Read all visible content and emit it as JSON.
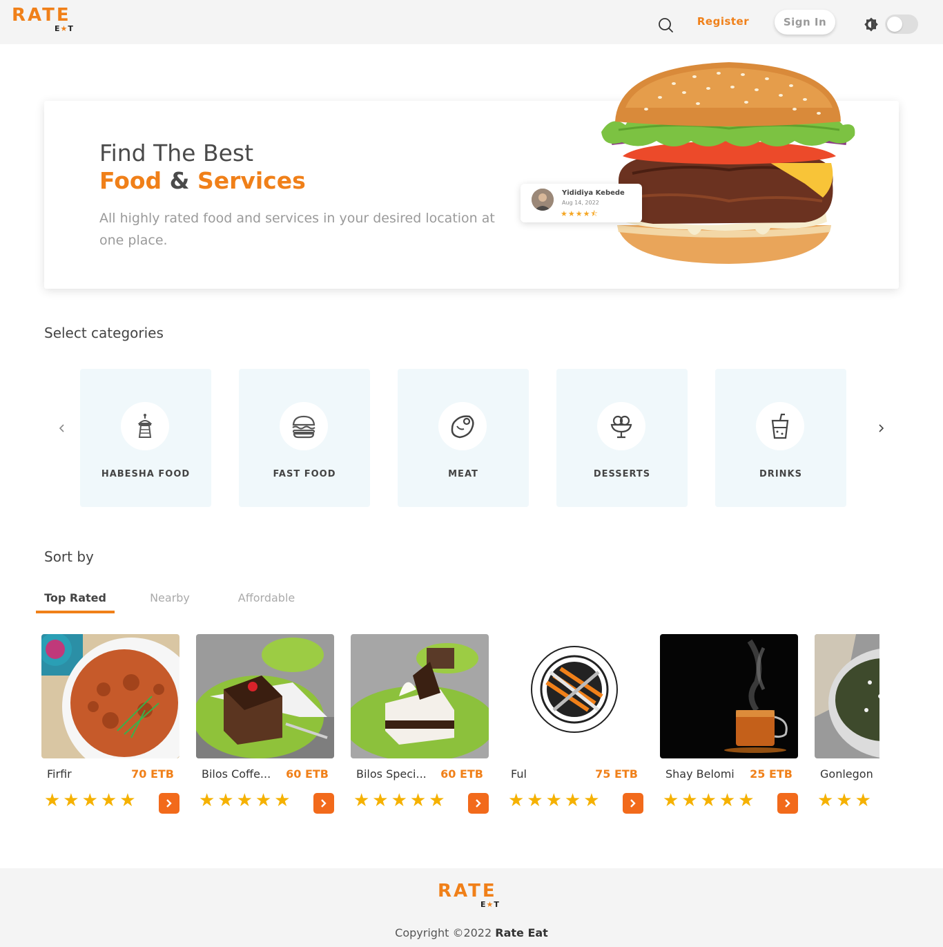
{
  "brand": {
    "logo_top": "RATE",
    "logo_bottom_left": "E",
    "logo_bottom_star": "★",
    "logo_bottom_right": "T"
  },
  "header": {
    "search_icon": "search-icon",
    "register_label": "Register",
    "signin_label": "Sign In",
    "theme_icon": "brightness-icon",
    "dark_mode_enabled": false
  },
  "hero": {
    "line1": "Find The Best",
    "line2_word1": "Food",
    "line2_amp": " & ",
    "line2_word2": "Services",
    "subtitle": "All highly rated food and services in your desired location at one place.",
    "review": {
      "name": "Yididiya Kebede",
      "date": "Aug 14, 2022",
      "stars": "★★★★⯪",
      "rating": 4.5
    }
  },
  "categories": {
    "title": "Select categories",
    "prev_icon": "chevron-left-icon",
    "next_icon": "chevron-right-icon",
    "items": [
      {
        "label": "HABESHA FOOD",
        "icon": "habesha-icon"
      },
      {
        "label": "FAST FOOD",
        "icon": "burger-icon"
      },
      {
        "label": "MEAT",
        "icon": "meat-icon"
      },
      {
        "label": "DESSERTS",
        "icon": "ice-cream-icon"
      },
      {
        "label": "DRINKS",
        "icon": "drink-icon"
      }
    ]
  },
  "sort": {
    "title": "Sort by",
    "tabs": [
      {
        "label": "Top Rated",
        "active": true
      },
      {
        "label": "Nearby",
        "active": false
      },
      {
        "label": "Affordable",
        "active": false
      }
    ]
  },
  "foods": [
    {
      "name": "Firfir",
      "price": "70 ETB",
      "stars": "★★★★★",
      "rating": 5
    },
    {
      "name": "Bilos Coffe...",
      "price": "60 ETB",
      "stars": "★★★★★",
      "rating": 5
    },
    {
      "name": "Bilos Speci...",
      "price": "60 ETB",
      "stars": "★★★★★",
      "rating": 5
    },
    {
      "name": "Ful",
      "price": "75 ETB",
      "stars": "★★★★★",
      "rating": 5
    },
    {
      "name": "Shay Belomi",
      "price": "25 ETB",
      "stars": "★★★★★",
      "rating": 5
    },
    {
      "name": "Gonlegon",
      "price": "",
      "stars": "★★★",
      "rating": 3
    }
  ],
  "footer": {
    "copyright_prefix": "Copyright ©2022 ",
    "copyright_brand": "Rate Eat"
  },
  "colors": {
    "accent": "#f08019",
    "star": "#f5b100",
    "category_bg": "#f0f8fb",
    "arrow_button": "#f26a1b"
  }
}
